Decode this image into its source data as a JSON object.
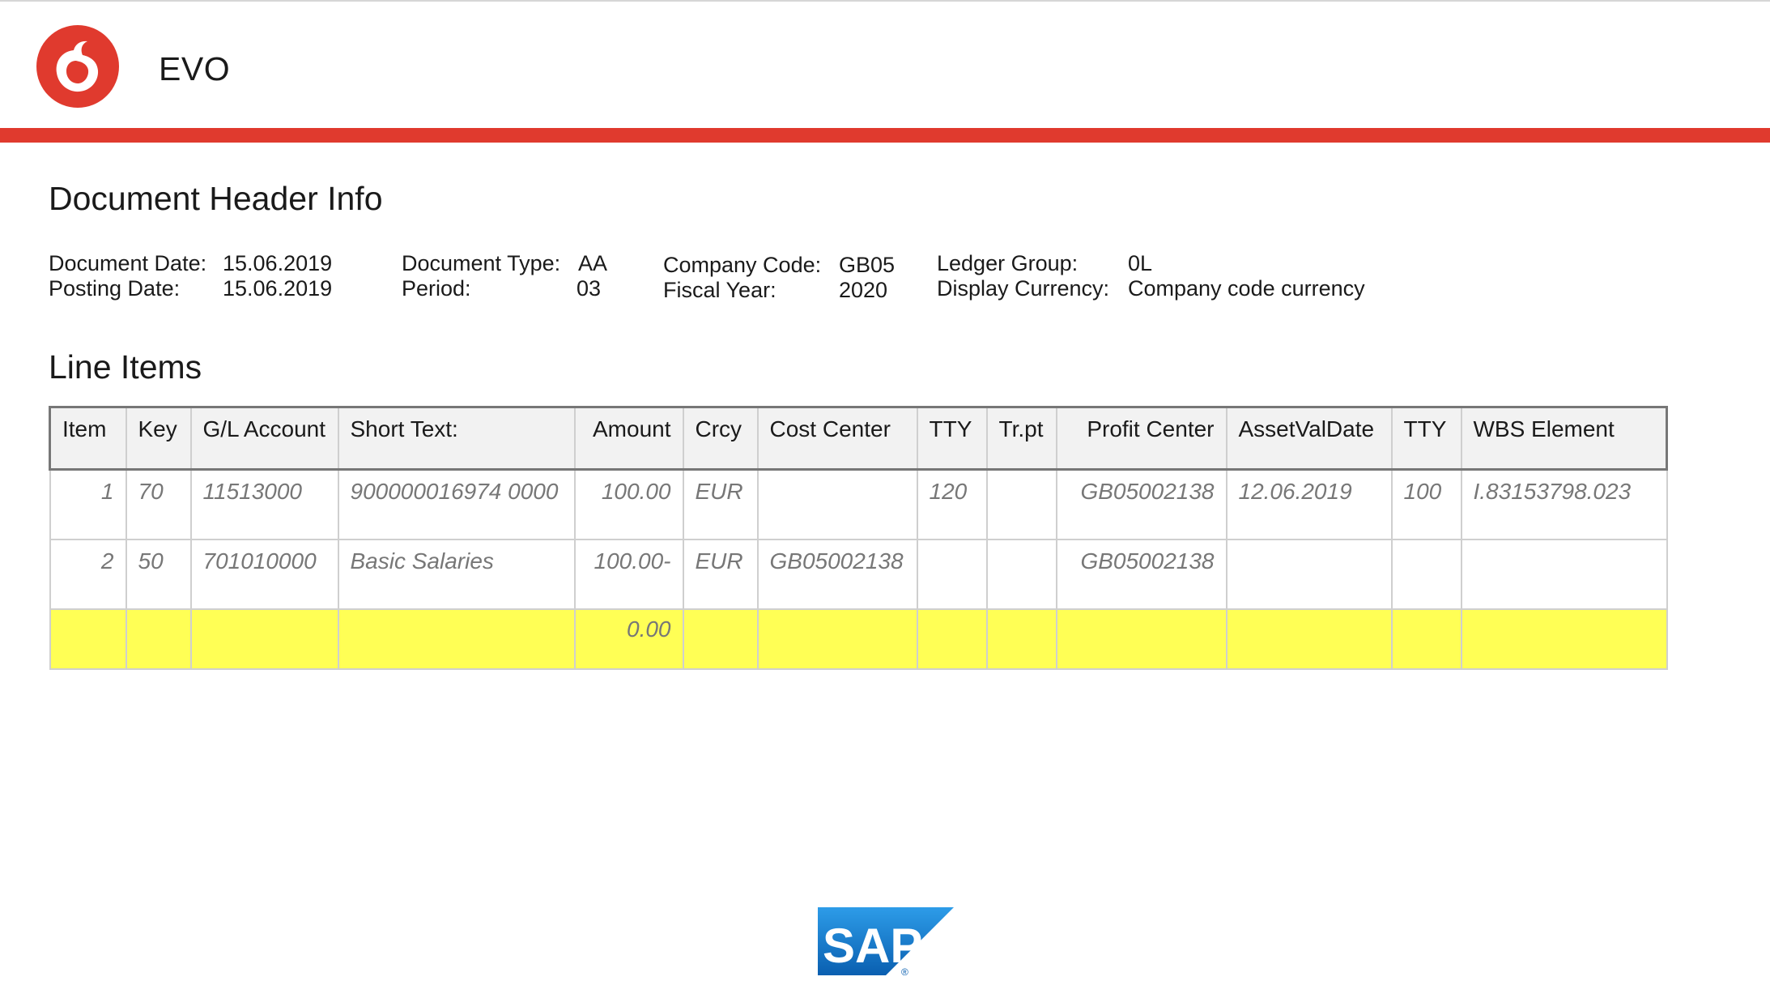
{
  "app": {
    "title": "EVO"
  },
  "colors": {
    "accent": "#e03a2e",
    "total_row": "#ffff55",
    "sap_blue": "#0a7ad1"
  },
  "icons": {
    "brand_logo": "vodafone-logo-icon",
    "footer_logo": "sap-logo-icon"
  },
  "header_info": {
    "title": "Document Header Info",
    "fields": [
      {
        "label": "Document Date:",
        "value": "15.06.2019"
      },
      {
        "label": "Posting Date:",
        "value": "15.06.2019"
      },
      {
        "label": "Document Type:",
        "value": "AA"
      },
      {
        "label": "Period:",
        "value": "03"
      },
      {
        "label": "Company Code:",
        "value": "GB05"
      },
      {
        "label": "Fiscal Year:",
        "value": "2020"
      },
      {
        "label": "Ledger Group:",
        "value": "0L"
      },
      {
        "label": "Display Currency:",
        "value": "Company code currency"
      }
    ]
  },
  "line_items": {
    "title": "Line Items",
    "columns": [
      "Item",
      "Key",
      "G/L Account",
      "Short Text:",
      "Amount",
      "Crcy",
      "Cost Center",
      "TTY",
      "Tr.pt",
      "Profit Center",
      "AssetValDate",
      "TTY",
      "WBS Element"
    ],
    "rows": [
      [
        "1",
        "70",
        "11513000",
        "900000016974 0000",
        "100.00",
        "EUR",
        "",
        "120",
        "",
        "GB05002138",
        "12.06.2019",
        "100",
        "I.83153798.023"
      ],
      [
        "2",
        "50",
        "701010000",
        "Basic Salaries",
        "100.00-",
        "EUR",
        "GB05002138",
        "",
        "",
        "GB05002138",
        "",
        "",
        ""
      ]
    ],
    "total": {
      "amount": "0.00"
    }
  },
  "footer": {
    "logo_text": "SAP"
  }
}
